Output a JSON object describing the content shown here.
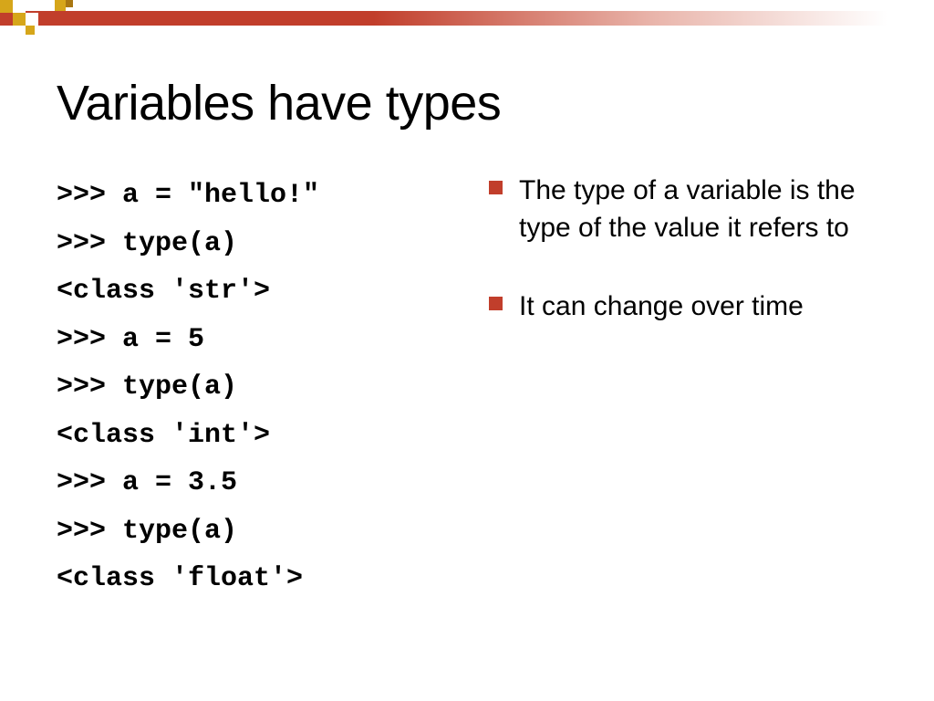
{
  "title": "Variables have types",
  "code": {
    "l0": ">>> a = \"hello!\"",
    "l1": ">>> type(a)",
    "l2": "<class 'str'>",
    "l3": ">>> a = 5",
    "l4": ">>> type(a)",
    "l5": "<class 'int'>",
    "l6": ">>> a = 3.5",
    "l7": ">>> type(a)",
    "l8": "<class 'float'>"
  },
  "bullets": {
    "b0": "The type of a variable is the type of the value it refers to",
    "b1": "It can change over time"
  }
}
